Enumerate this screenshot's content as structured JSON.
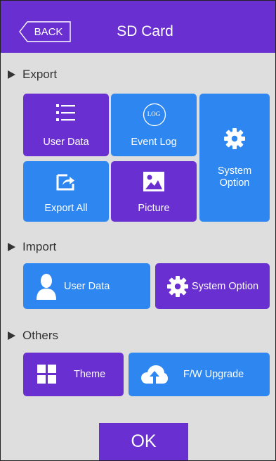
{
  "header": {
    "back_label": "BACK",
    "title": "SD Card"
  },
  "sections": {
    "export": "Export",
    "import": "Import",
    "others": "Others"
  },
  "export": {
    "user_data": "User Data",
    "event_log": "Event Log",
    "event_log_icon_text": "LOG",
    "system_option": "System Option",
    "export_all": "Export All",
    "picture": "Picture"
  },
  "import": {
    "user_data": "User Data",
    "system_option": "System Option"
  },
  "others": {
    "theme": "Theme",
    "fw_upgrade": "F/W Upgrade"
  },
  "ok_label": "OK",
  "colors": {
    "accent_purple": "#6a2fd0",
    "accent_blue": "#2e86f0",
    "background": "#dedede"
  },
  "icons": [
    "back-arrow-icon",
    "list-icon",
    "log-icon",
    "gear-icon",
    "export-icon",
    "picture-icon",
    "user-icon",
    "grid-icon",
    "cloud-upload-icon",
    "triangle-icon"
  ]
}
